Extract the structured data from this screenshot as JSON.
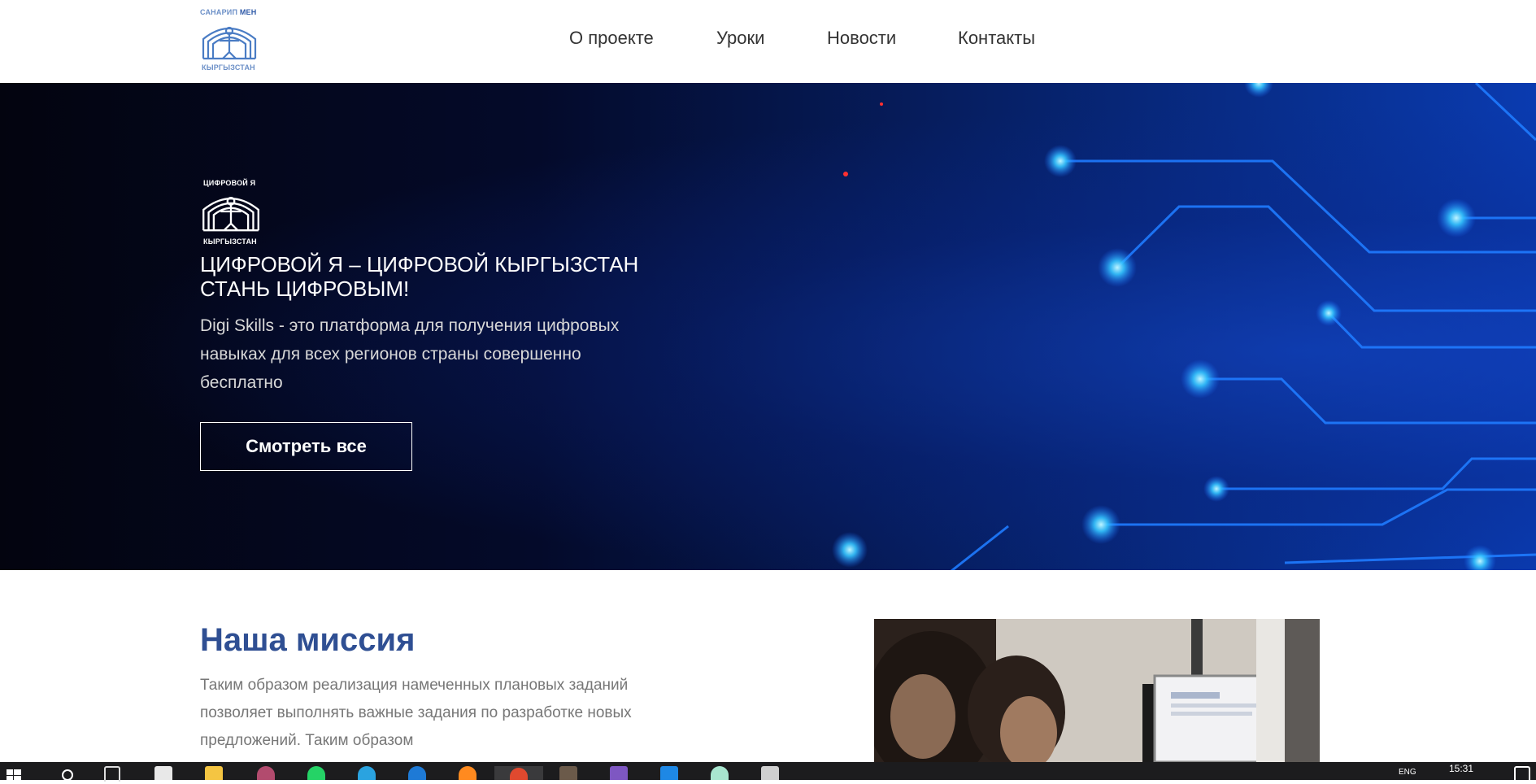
{
  "header": {
    "logo": {
      "top_text_a": "САНАРИП",
      "top_text_b": "МЕН",
      "bottom_text": "КЫРГЫЗСТАН"
    },
    "nav": [
      "О проекте",
      "Уроки",
      "Новости",
      "Контакты"
    ]
  },
  "hero": {
    "logo": {
      "top_text_a": "ЦИФРОВОЙ",
      "top_text_b": "Я",
      "bottom_text": "КЫРГЫЗСТАН"
    },
    "title_line1": "ЦИФРОВОЙ Я – ЦИФРОВОЙ КЫРГЫЗСТАН",
    "title_line2": "СТАНЬ ЦИФРОВЫМ!",
    "description": "Digi Skills - это платформа для получения цифровых навыках для всех регионов страны совершенно бесплатно",
    "button_label": "Смотреть все"
  },
  "mission": {
    "title": "Наша миссия",
    "text": "Таким образом реализация намеченных плановых заданий позволяет выполнять важные задания по разработке новых предложений. Таким образом"
  },
  "taskbar": {
    "time": "15:31",
    "lang": "ENG",
    "icons": [
      "start-icon",
      "search-icon",
      "task-view-icon",
      "store-icon",
      "file-explorer-icon",
      "app-icon",
      "whatsapp-icon",
      "telegram-icon",
      "app-blue-icon",
      "firefox-icon",
      "chrome-icon",
      "sublime-icon",
      "visual-studio-icon",
      "vscode-icon",
      "app-green-icon",
      "app-gray-icon"
    ]
  },
  "colors": {
    "mission_title": "#2f4f93",
    "logo_blue": "#4a7cc4",
    "hero_dark": "#03040f",
    "hero_blue": "#0a3bb0",
    "circuit": "#1a6cff"
  }
}
